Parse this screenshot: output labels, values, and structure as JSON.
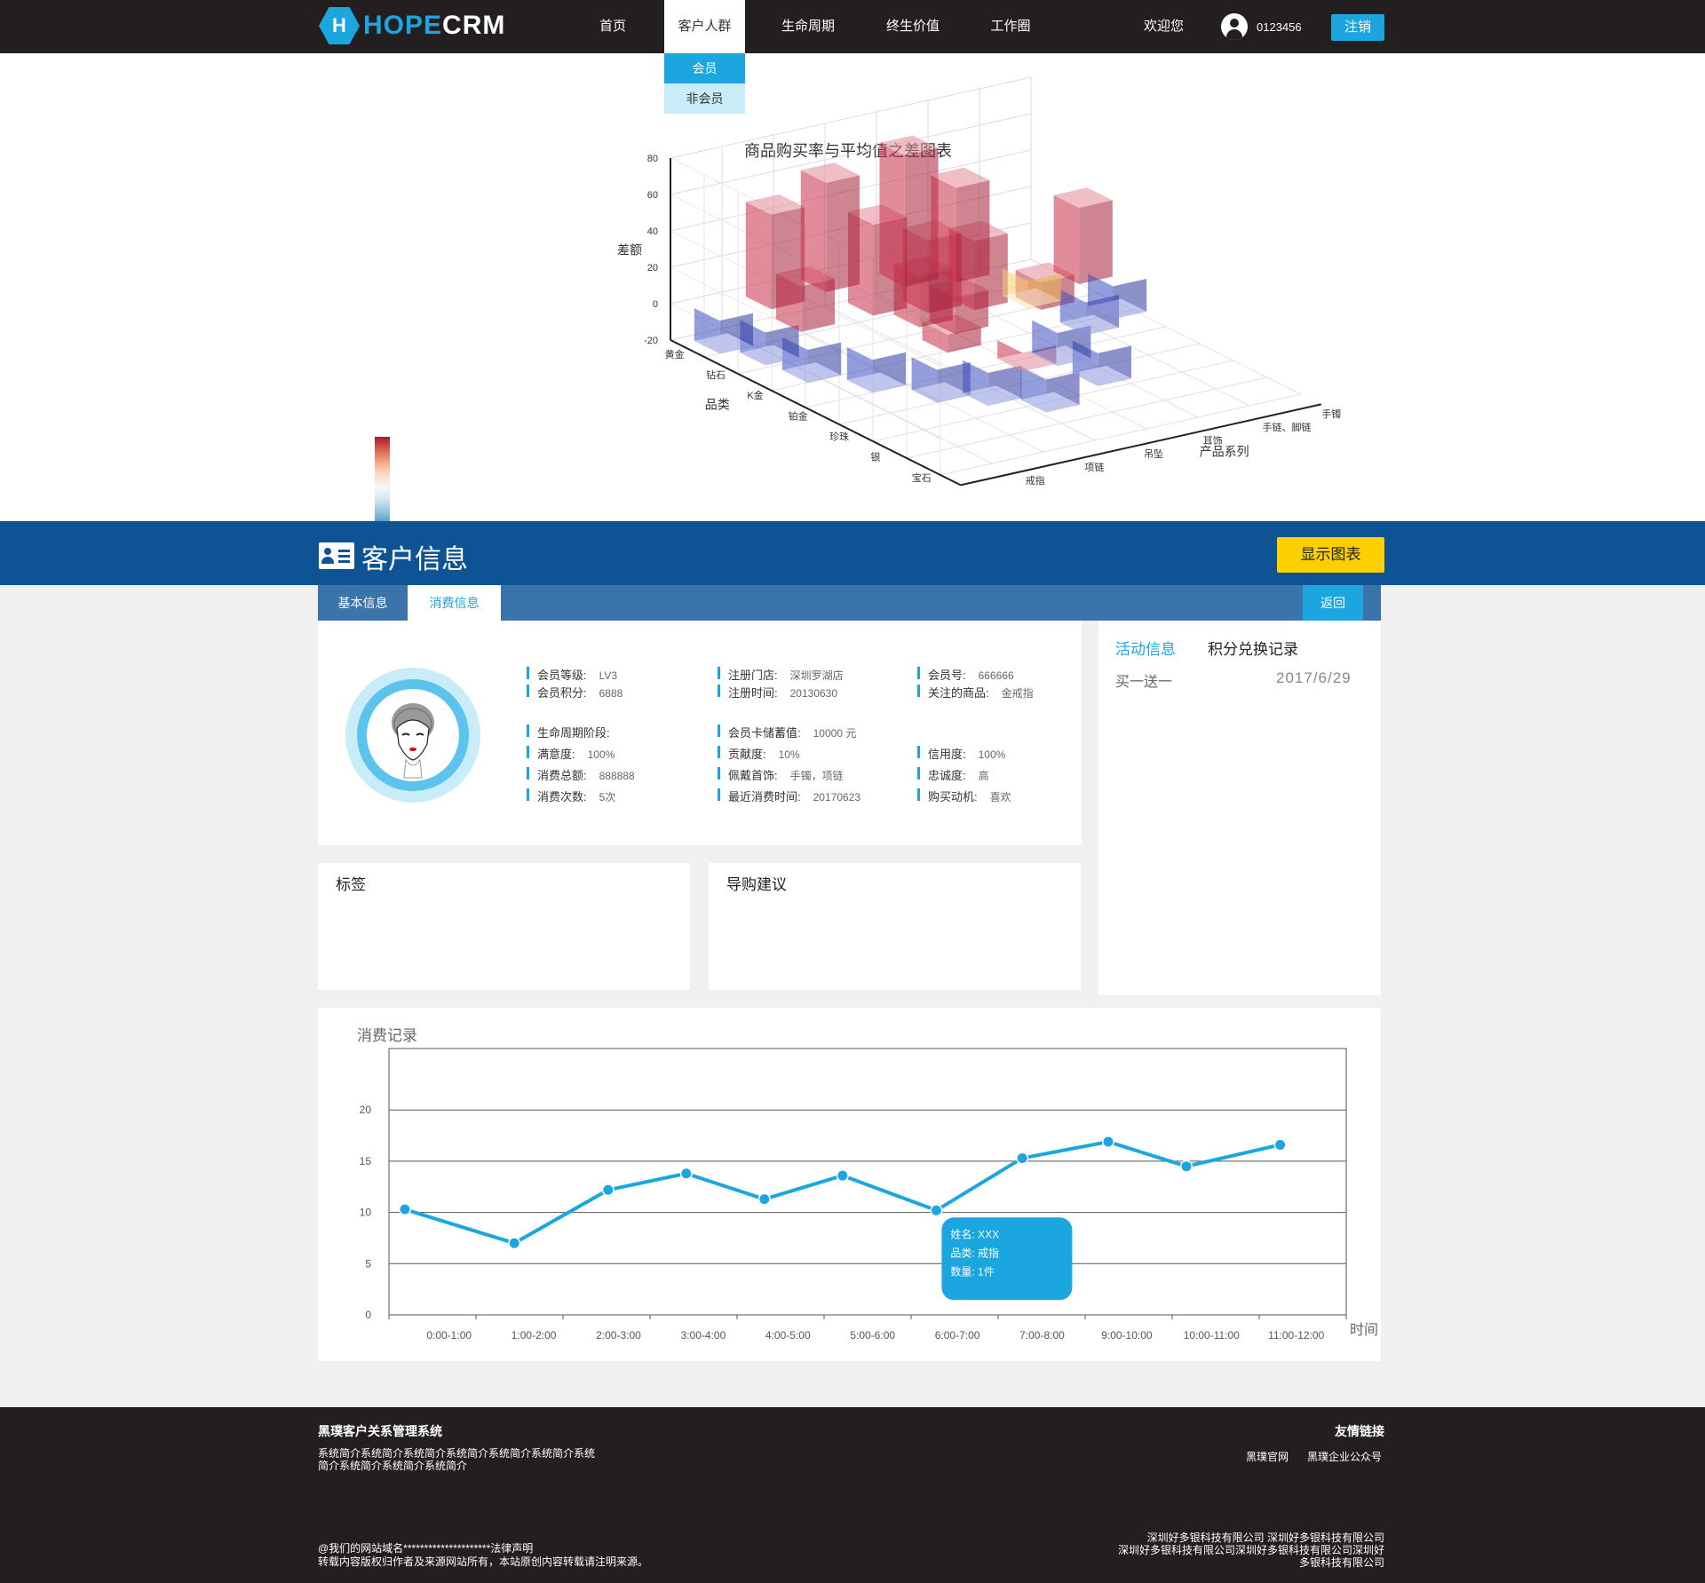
{
  "nav": {
    "logo_mark": "H",
    "logo_hope": "HOPE",
    "logo_crm": "CRM",
    "items": [
      "首页",
      "客户人群",
      "生命周期",
      "终生价值",
      "工作圈"
    ],
    "dropdown": [
      "会员",
      "非会员"
    ],
    "welcome": "欢迎您",
    "username": "0123456",
    "logout": "注销"
  },
  "top_chart": {
    "title": "商品购买率与平均值之差图表",
    "z_label": "差额",
    "z_ticks": [
      "80",
      "60",
      "40",
      "20",
      "0",
      "-20"
    ],
    "x_label": "品类",
    "x_ticks": [
      "黄金",
      "钻石",
      "K金",
      "铂金",
      "珍珠",
      "银",
      "宝石"
    ],
    "y_label": "产品系列",
    "y_ticks": [
      "手镯",
      "手链、脚链",
      "耳饰",
      "吊坠",
      "项链",
      "戒指"
    ]
  },
  "banner": {
    "title": "客户信息",
    "show_chart": "显示图表"
  },
  "tabs": {
    "basic": "基本信息",
    "consume": "消费信息",
    "back": "返回"
  },
  "info": {
    "fields": [
      {
        "label": "会员等级:",
        "value": "LV3"
      },
      {
        "label": "会员积分:",
        "value": "6888"
      },
      {
        "label": "注册门店:",
        "value": "深圳罗湖店"
      },
      {
        "label": "注册时间:",
        "value": "20130630"
      },
      {
        "label": "会员号:",
        "value": "666666"
      },
      {
        "label": "关注的商品:",
        "value": "金戒指"
      },
      {
        "label": "生命周期阶段:",
        "value": ""
      },
      {
        "label": "会员卡储蓄值:",
        "value": "10000  元"
      },
      {
        "label": "满意度:",
        "value": "100%"
      },
      {
        "label": "贡献度:",
        "value": "10%"
      },
      {
        "label": "信用度:",
        "value": "100%"
      },
      {
        "label": "消费总额:",
        "value": "888888"
      },
      {
        "label": "佩戴首饰:",
        "value": "手镯，项链"
      },
      {
        "label": "忠诚度:",
        "value": "高"
      },
      {
        "label": "消费次数:",
        "value": "5次"
      },
      {
        "label": "最近消费时间:",
        "value": "20170623"
      },
      {
        "label": "购买动机:",
        "value": "喜欢"
      }
    ]
  },
  "side": {
    "tab_activity": "活动信息",
    "tab_points": "积分兑换记录",
    "item": "买一送一",
    "date": "2017/6/29"
  },
  "tags_title": "标签",
  "advice_title": "导购建议",
  "record": {
    "title": "消费记录",
    "x_axis_label": "时间",
    "tooltip": [
      "姓名: XXX",
      "品类: 戒指",
      "数量: 1件"
    ]
  },
  "chart_data": {
    "type": "line",
    "title": "消费记录",
    "xlabel": "时间",
    "ylabel": "",
    "categories": [
      "0:00-1:00",
      "1:00-2:00",
      "2:00-3:00",
      "3:00-4:00",
      "4:00-5:00",
      "5:00-6:00",
      "6:00-7:00",
      "7:00-8:00",
      "9:00-10:00",
      "10:00-11:00",
      "11:00-12:00"
    ],
    "x_positions": [
      0,
      1.4,
      2.6,
      3.6,
      4.6,
      5.6,
      6.8,
      7.9,
      9.0,
      10.0,
      11.2
    ],
    "values": [
      10.3,
      7.0,
      12.2,
      13.8,
      11.3,
      13.6,
      10.2,
      15.3,
      16.9,
      14.5,
      16.6
    ],
    "yticks": [
      0,
      5,
      10,
      15,
      20
    ],
    "ylim": [
      0,
      26
    ],
    "grid": true,
    "color": "#1ba6e0"
  },
  "footer": {
    "title": "黑璞客户关系管理系统",
    "desc_line1": "系统简介系统简介系统简介系统简介系统简介系统简介系统",
    "desc_line2": "简介系统简介系统简介系统简介",
    "links_title": "友情链接",
    "link1": "黑璞官网",
    "link2": "黑璞企业公众号",
    "legal1": "@我们的网站域名*********************法律声明",
    "legal2": "转载内容版权归作者及来源网站所有，本站原创内容转载请注明来源。",
    "company1": "深圳好多银科技有限公司 深圳好多银科技有限公司",
    "company2": "深圳好多银科技有限公司深圳好多银科技有限公司深圳好",
    "company3": "多银科技有限公司"
  }
}
